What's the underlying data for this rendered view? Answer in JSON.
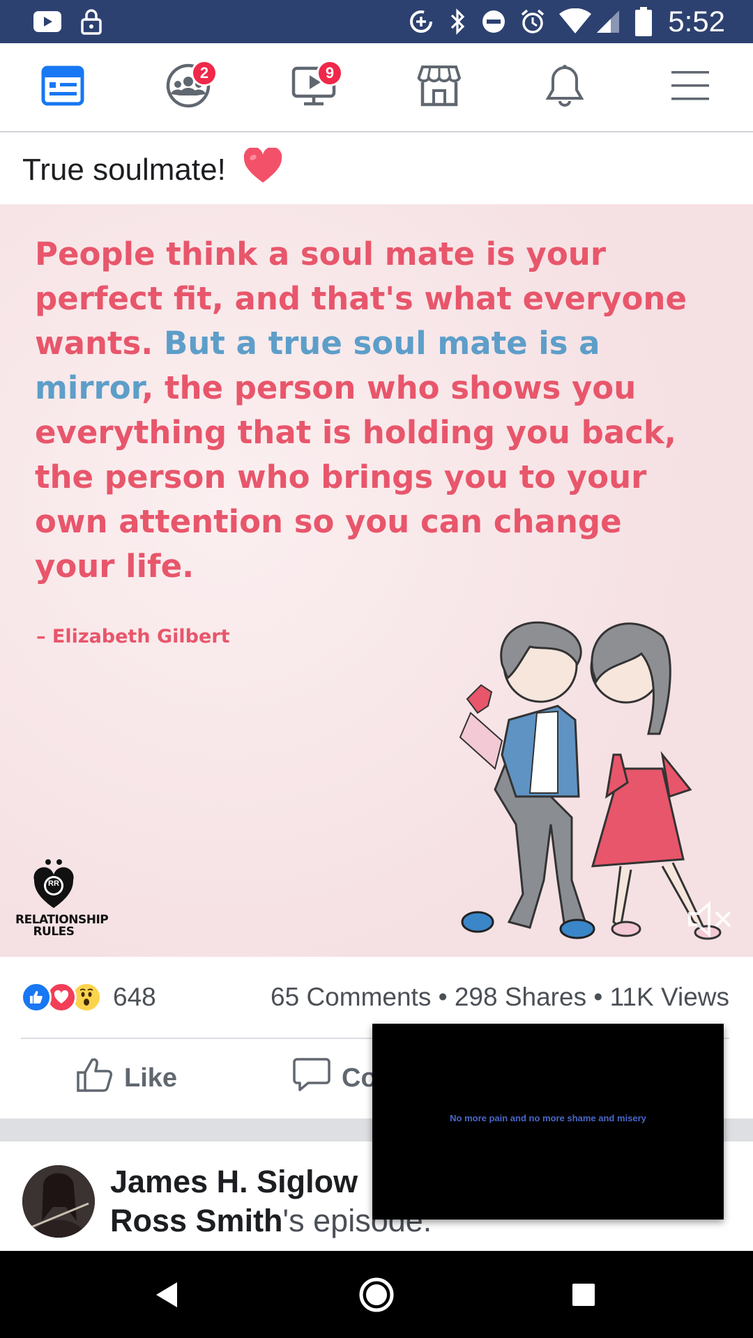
{
  "status_bar": {
    "time": "5:52",
    "icons": [
      "youtube-icon",
      "lock-icon",
      "data-saver-icon",
      "bluetooth-icon",
      "do-not-disturb-icon",
      "alarm-icon",
      "wifi-icon",
      "signal-icon",
      "battery-icon"
    ]
  },
  "nav": {
    "items": [
      {
        "name": "news-feed",
        "icon": "news-feed-icon",
        "active": true
      },
      {
        "name": "groups",
        "icon": "groups-icon",
        "badge": "2"
      },
      {
        "name": "watch",
        "icon": "watch-icon",
        "badge": "9"
      },
      {
        "name": "marketplace",
        "icon": "marketplace-icon"
      },
      {
        "name": "notifications",
        "icon": "bell-icon"
      },
      {
        "name": "menu",
        "icon": "hamburger-menu-icon"
      }
    ]
  },
  "post": {
    "text": "True soulmate!",
    "image": {
      "quote_part1": "People think a soul mate is your perfect fit, and that's what everyone wants. ",
      "quote_blue": "But a true soul mate is a mirror",
      "quote_part2": ", the person who shows you everything that is holding you back, the person who brings you to your own attention so you can change your life.",
      "author": "– Elizabeth Gilbert",
      "logo_badge": "RR",
      "logo_text_line1": "RELATIONSHIP",
      "logo_text_line2": "RULES"
    },
    "reactions": [
      "like-icon",
      "love-icon",
      "wow-icon"
    ],
    "reaction_count": "648",
    "stats": "65 Comments • 298 Shares • 11K Views",
    "actions": {
      "like": "Like",
      "comment": "Co"
    }
  },
  "next_story": {
    "name": "James H. Siglow",
    "line2_bold": "Ross Smith",
    "line2_rest": "'s episode."
  },
  "video_overlay": {
    "caption": "No  more  pain  and  no  more  shame  and  misery"
  },
  "colors": {
    "status_bar": "#2d4170",
    "facebook_blue": "#1877f2",
    "badge_red": "#f02849",
    "quote_pink": "#e8566b",
    "quote_blue": "#5d9ec9"
  }
}
